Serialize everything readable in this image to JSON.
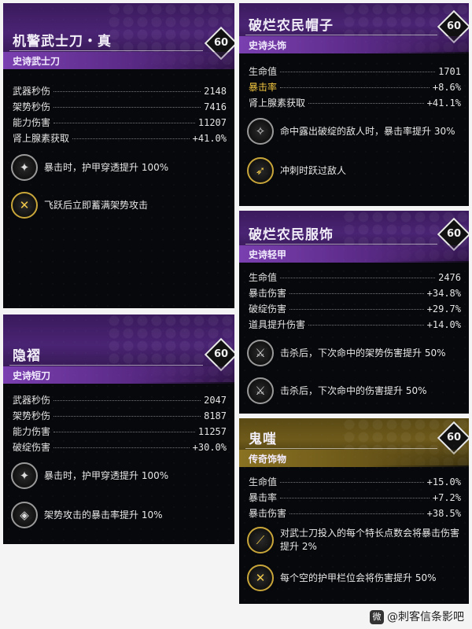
{
  "cards": {
    "katana": {
      "title": "机警武士刀・真",
      "subtitle": "史诗武士刀",
      "level": "60",
      "stats": [
        {
          "name": "武器秒伤",
          "value": "2148"
        },
        {
          "name": "架势秒伤",
          "value": "7416"
        },
        {
          "name": "能力伤害",
          "value": "11207"
        },
        {
          "name": "肾上腺素获取",
          "value": "+41.0%"
        }
      ],
      "perks": [
        {
          "icon": "armor-pierce-icon",
          "text": "暴击时，护甲穿透提升 100%"
        },
        {
          "icon": "crossed-blades-icon",
          "text": "飞跃后立即蓄满架势攻击"
        }
      ]
    },
    "hat": {
      "title": "破烂农民帽子",
      "subtitle": "史诗头饰",
      "level": "60",
      "stats": [
        {
          "name": "生命值",
          "value": "1701"
        },
        {
          "name": "暴击率",
          "value": "+8.6%"
        },
        {
          "name": "肾上腺素获取",
          "value": "+41.1%"
        }
      ],
      "perks": [
        {
          "icon": "compass-icon",
          "text": "命中露出破绽的敌人时，暴击率提升 30%"
        },
        {
          "icon": "dash-icon",
          "text": "冲刺时跃过敌人"
        }
      ]
    },
    "armor": {
      "title": "破烂农民服饰",
      "subtitle": "史诗轻甲",
      "level": "60",
      "stats": [
        {
          "name": "生命值",
          "value": "2476"
        },
        {
          "name": "暴击伤害",
          "value": "+34.8%"
        },
        {
          "name": "破绽伤害",
          "value": "+29.7%"
        },
        {
          "name": "道具提升伤害",
          "value": "+14.0%"
        }
      ],
      "perks": [
        {
          "icon": "crossed-swords-icon",
          "text": "击杀后，下次命中的架势伤害提升 50%"
        },
        {
          "icon": "crossed-swords-icon",
          "text": "击杀后，下次命中的伤害提升 50%"
        }
      ]
    },
    "shortblade": {
      "title": "隐褶",
      "subtitle": "史诗短刀",
      "level": "60",
      "stats": [
        {
          "name": "武器秒伤",
          "value": "2047"
        },
        {
          "name": "架势秒伤",
          "value": "8187"
        },
        {
          "name": "能力伤害",
          "value": "11257"
        },
        {
          "name": "破绽伤害",
          "value": "+30.0%"
        }
      ],
      "perks": [
        {
          "icon": "armor-pierce-icon",
          "text": "暴击时，护甲穿透提升 100%"
        },
        {
          "icon": "stance-crit-icon",
          "text": "架势攻击的暴击率提升 10%"
        }
      ]
    },
    "charm": {
      "title": "鬼嗤",
      "subtitle": "传奇饰物",
      "level": "60",
      "stats": [
        {
          "name": "生命值",
          "value": "+15.0%"
        },
        {
          "name": "暴击率",
          "value": "+7.2%"
        },
        {
          "name": "暴击伤害",
          "value": "+38.5%"
        }
      ],
      "perks": [
        {
          "icon": "katana-gold-icon",
          "text": "对武士刀投入的每个特长点数会将暴击伤害提升 2%"
        },
        {
          "icon": "crossed-blades-gold-icon",
          "text": "每个空的护甲栏位会将伤害提升 50%"
        }
      ]
    }
  },
  "watermark": "@刺客信条影吧",
  "colors": {
    "epic": "#5a2a86",
    "legendary": "#6e5a1a",
    "highlight": "#f2c640"
  }
}
